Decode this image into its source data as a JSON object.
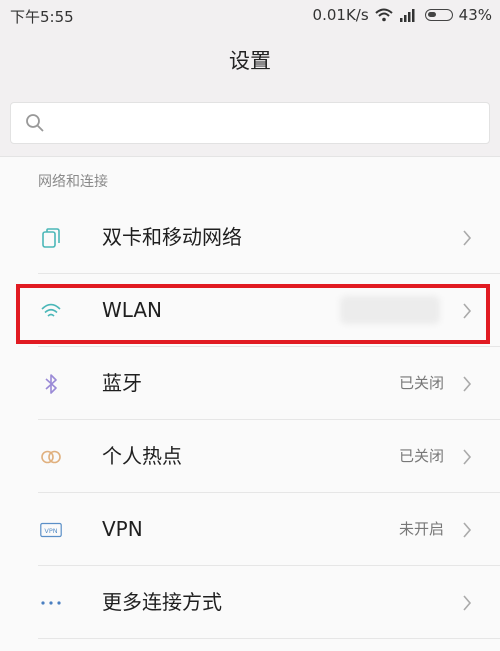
{
  "status_bar": {
    "time": "下午5:55",
    "network_speed": "0.01K/s",
    "battery": "43%",
    "battery_level": 0.43
  },
  "header": {
    "title": "设置"
  },
  "search": {
    "placeholder": ""
  },
  "section": {
    "title": "网络和连接"
  },
  "items": [
    {
      "label": "双卡和移动网络",
      "status": "",
      "icon": "sim-card-icon"
    },
    {
      "label": "WLAN",
      "status": "",
      "icon": "wifi-icon"
    },
    {
      "label": "蓝牙",
      "status": "已关闭",
      "icon": "bluetooth-icon"
    },
    {
      "label": "个人热点",
      "status": "已关闭",
      "icon": "hotspot-icon"
    },
    {
      "label": "VPN",
      "status": "未开启",
      "icon": "vpn-icon"
    },
    {
      "label": "更多连接方式",
      "status": "",
      "icon": "more-dots-icon"
    }
  ],
  "colors": {
    "highlight": "#e11b22",
    "icon_accent": "#4bb7b8",
    "bluetooth": "#9a8ad6",
    "hotspot": "#e0b07e"
  }
}
